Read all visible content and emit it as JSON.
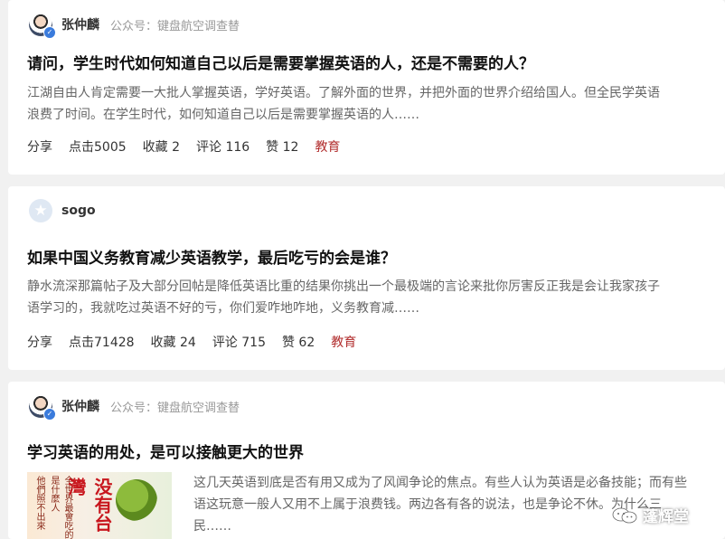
{
  "feed": [
    {
      "author": "张仲麟",
      "source": "公众号：键盘航空调查替",
      "title": "请问，学生时代如何知道自己以后是需要掌握英语的人，还是不需要的人？",
      "excerpt_line1": "江湖自由人肯定需要一大批人掌握英语，学好英语。了解外面的世界，并把外面的世界介绍给国人。但全民学英语",
      "excerpt_line2": "浪费了时间。在学生时代，如何知道自己以后是需要掌握英语的人……",
      "share": "分享",
      "clicks": "点击5005",
      "favorites": "收藏 2",
      "comments": "评论 116",
      "likes": "赞 12",
      "tag": "教育"
    },
    {
      "author": "sogo",
      "source": "",
      "title": "如果中国义务教育减少英语教学，最后吃亏的会是谁？",
      "excerpt_line1": "静水流深那篇帖子及大部分回帖是降低英语比重的结果你挑出一个最极端的言论来批你厉害反正我是会让我家孩子",
      "excerpt_line2": "语学习的，我就吃过英语不好的亏，你们爱咋地咋地，义务教育减……",
      "share": "分享",
      "clicks": "点击71428",
      "favorites": "收藏 24",
      "comments": "评论 715",
      "likes": "赞 62",
      "tag": "教育"
    },
    {
      "author": "张仲麟",
      "source": "公众号：键盘航空调查替",
      "title": "学习英语的用处，是可以接触更大的世界",
      "excerpt_line1": "这几天英语到底是否有用又成为了风闻争论的焦点。有些人认为英语是必备技能；而有些",
      "excerpt_line2": "语这玩意一般人又用不上属于浪费钱。两边各有各的说法，也是争论不休。为什么三",
      "excerpt_line3": "民……",
      "image_text_big": "没有台灣",
      "image_text_left": "他們照不出來",
      "image_text_right": "全世界最會吃的是什麼人"
    }
  ],
  "watermark": "蓬辉堂"
}
